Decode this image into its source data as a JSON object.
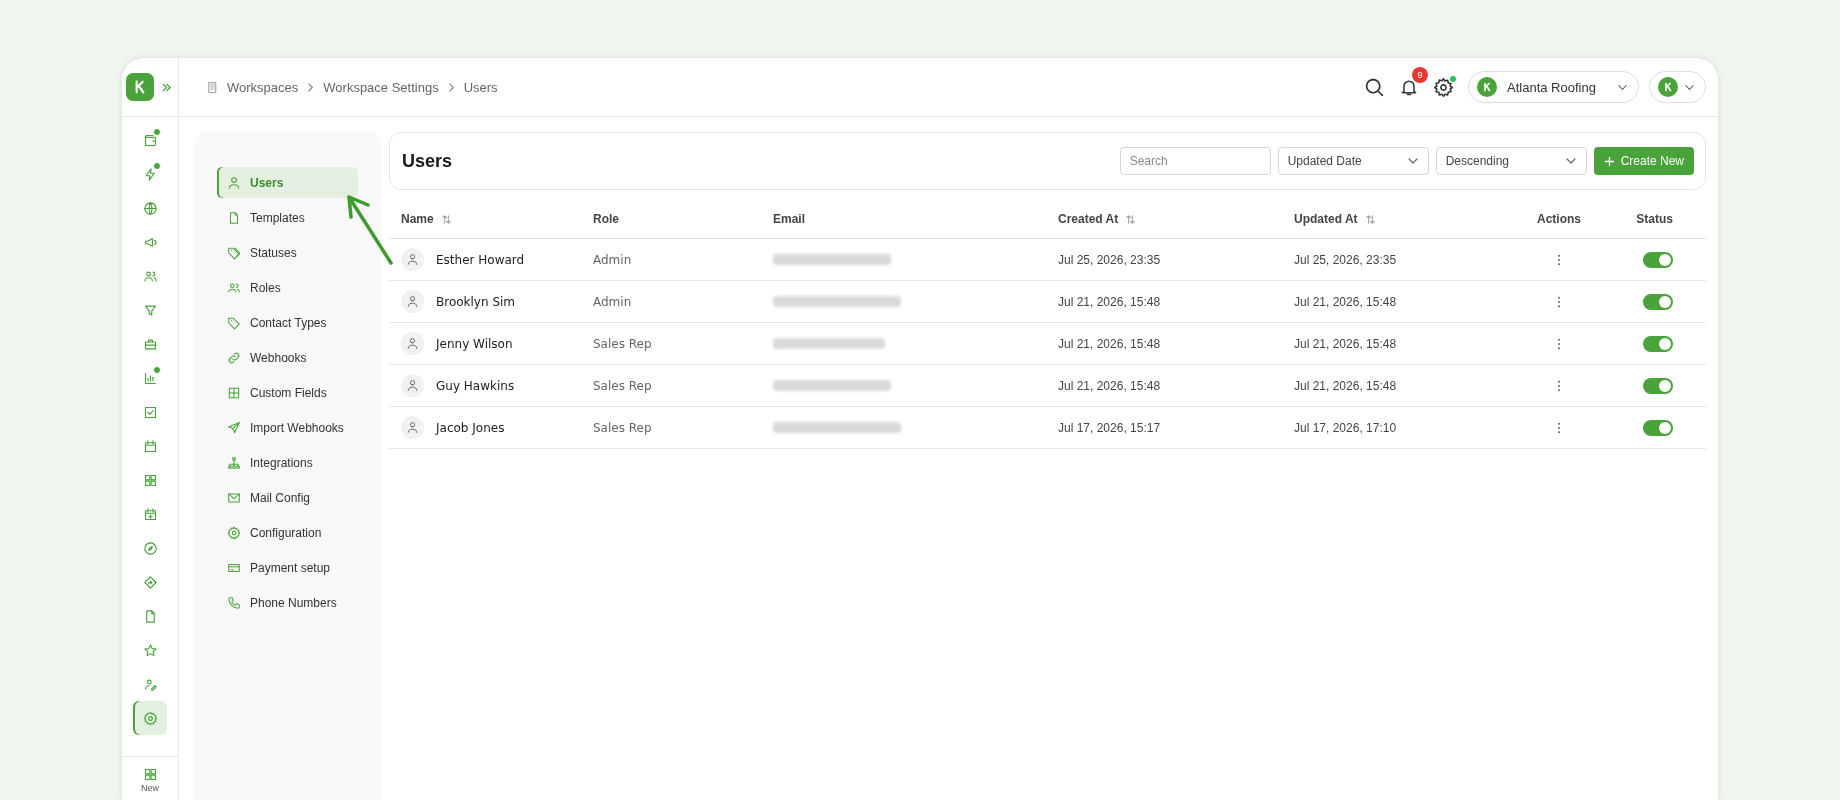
{
  "rail": {
    "items": [
      {
        "kind": "wallet",
        "dot": true,
        "selected": false
      },
      {
        "kind": "lightning",
        "dot": true,
        "selected": false
      },
      {
        "kind": "globe",
        "dot": false,
        "selected": false
      },
      {
        "kind": "megaphone",
        "dot": false,
        "selected": false
      },
      {
        "kind": "people",
        "dot": false,
        "selected": false
      },
      {
        "kind": "funnel",
        "dot": false,
        "selected": false
      },
      {
        "kind": "briefcase",
        "dot": false,
        "selected": false
      },
      {
        "kind": "barchart",
        "dot": true,
        "selected": false
      },
      {
        "kind": "checkbox",
        "dot": false,
        "selected": false
      },
      {
        "kind": "calendar",
        "dot": false,
        "selected": false
      },
      {
        "kind": "grid",
        "dot": false,
        "selected": false
      },
      {
        "kind": "calendarplus",
        "dot": false,
        "selected": false
      },
      {
        "kind": "compass",
        "dot": false,
        "selected": false
      },
      {
        "kind": "diamond",
        "dot": false,
        "selected": false
      },
      {
        "kind": "document",
        "dot": false,
        "selected": false
      },
      {
        "kind": "star",
        "dot": false,
        "selected": false
      },
      {
        "kind": "useredit",
        "dot": false,
        "selected": false
      },
      {
        "kind": "gear",
        "dot": false,
        "selected": true
      }
    ],
    "new_label": "New"
  },
  "breadcrumb": [
    "Workspaces",
    "Workspace Settings",
    "Users"
  ],
  "header": {
    "notification_count": "9",
    "settings_dot": true,
    "workspace": "Atlanta Roofing"
  },
  "settings_menu": [
    {
      "kind": "user",
      "label": "Users",
      "selected": true
    },
    {
      "kind": "document",
      "label": "Templates",
      "selected": false
    },
    {
      "kind": "tags",
      "label": "Statuses",
      "selected": false
    },
    {
      "kind": "people",
      "label": "Roles",
      "selected": false
    },
    {
      "kind": "tag",
      "label": "Contact Types",
      "selected": false
    },
    {
      "kind": "link",
      "label": "Webhooks",
      "selected": false
    },
    {
      "kind": "table",
      "label": "Custom Fields",
      "selected": false
    },
    {
      "kind": "send",
      "label": "Import Webhooks",
      "selected": false
    },
    {
      "kind": "sitemap",
      "label": "Integrations",
      "selected": false
    },
    {
      "kind": "mail",
      "label": "Mail Config",
      "selected": false
    },
    {
      "kind": "gear",
      "label": "Configuration",
      "selected": false
    },
    {
      "kind": "card",
      "label": "Payment setup",
      "selected": false
    },
    {
      "kind": "phone",
      "label": "Phone Numbers",
      "selected": false
    }
  ],
  "page": {
    "title": "Users",
    "search": {
      "placeholder": "Search"
    },
    "sort_field": "Updated Date",
    "sort_order": "Descending",
    "create_button": "Create New"
  },
  "table": {
    "columns": [
      {
        "label": "Name",
        "sortable": true
      },
      {
        "label": "Role",
        "sortable": false
      },
      {
        "label": "Email",
        "sortable": false
      },
      {
        "label": "Created At",
        "sortable": true
      },
      {
        "label": "Updated At",
        "sortable": true
      },
      {
        "label": "Actions",
        "sortable": false
      },
      {
        "label": "Status",
        "sortable": false
      }
    ],
    "rows": [
      {
        "name": "Esther Howard",
        "role": "Admin",
        "created": "Jul 25, 2026, 23:35",
        "updated": "Jul 25, 2026, 23:35",
        "on": true
      },
      {
        "name": "Brooklyn Sim",
        "role": "Admin",
        "created": "Jul 21, 2026, 15:48",
        "updated": "Jul 21, 2026, 15:48",
        "on": true
      },
      {
        "name": "Jenny Wilson",
        "role": "Sales Rep",
        "created": "Jul 21, 2026, 15:48",
        "updated": "Jul 21, 2026, 15:48",
        "on": true
      },
      {
        "name": "Guy Hawkins",
        "role": "Sales Rep",
        "created": "Jul 21, 2026, 15:48",
        "updated": "Jul 21, 2026, 15:48",
        "on": true
      },
      {
        "name": "Jacob Jones",
        "role": "Sales Rep",
        "created": "Jul 17, 2026, 15:17",
        "updated": "Jul 17, 2026, 17:10",
        "on": true
      }
    ]
  }
}
